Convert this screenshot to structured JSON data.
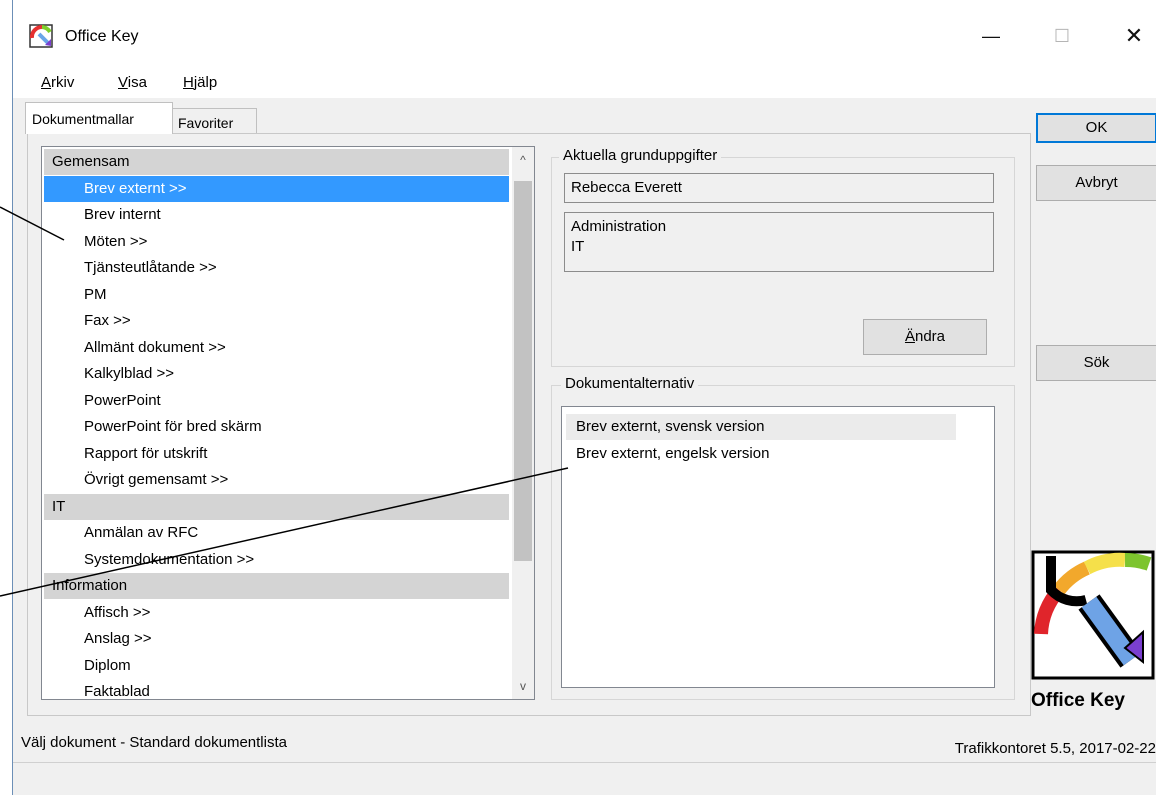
{
  "window": {
    "title": "Office Key",
    "minimize": "—",
    "maximize": "☐",
    "close": "✕"
  },
  "menu": {
    "items": [
      {
        "label": "Arkiv",
        "accel": "A",
        "rest": "rkiv"
      },
      {
        "label": "Visa",
        "accel": "V",
        "rest": "isa"
      },
      {
        "label": "Hjälp",
        "accel": "H",
        "rest": "jälp"
      }
    ]
  },
  "tabs": [
    {
      "label": "Dokumentmallar",
      "active": true
    },
    {
      "label": "Favoriter",
      "active": false
    }
  ],
  "doclist": {
    "rows": [
      {
        "type": "group",
        "label": "Gemensam"
      },
      {
        "type": "item",
        "label": "Brev externt >>",
        "selected": true
      },
      {
        "type": "item",
        "label": "Brev internt"
      },
      {
        "type": "item",
        "label": "Möten >>"
      },
      {
        "type": "item",
        "label": "Tjänsteutlåtande >>"
      },
      {
        "type": "item",
        "label": "PM"
      },
      {
        "type": "item",
        "label": "Fax >>"
      },
      {
        "type": "item",
        "label": "Allmänt dokument >>"
      },
      {
        "type": "item",
        "label": "Kalkylblad >>"
      },
      {
        "type": "item",
        "label": "PowerPoint"
      },
      {
        "type": "item",
        "label": "PowerPoint för bred skärm"
      },
      {
        "type": "item",
        "label": "Rapport för utskrift"
      },
      {
        "type": "item",
        "label": "Övrigt gemensamt >>"
      },
      {
        "type": "group",
        "label": "IT"
      },
      {
        "type": "item",
        "label": "Anmälan av RFC"
      },
      {
        "type": "item",
        "label": "Systemdokumentation >>"
      },
      {
        "type": "group",
        "label": "Information"
      },
      {
        "type": "item",
        "label": "Affisch >>"
      },
      {
        "type": "item",
        "label": "Anslag >>"
      },
      {
        "type": "item",
        "label": "Diplom"
      },
      {
        "type": "item",
        "label": "Faktablad"
      }
    ]
  },
  "grunduppgifter": {
    "label": "Aktuella grunduppgifter",
    "name": "Rebecca Everett",
    "dept_line1": "Administration",
    "dept_line2": "IT",
    "change_button": "Ändra",
    "change_accel": "Ä",
    "change_rest": "ndra"
  },
  "dokumentalternativ": {
    "label": "Dokumentalternativ",
    "options": [
      "Brev externt, svensk version",
      "Brev externt, engelsk version"
    ]
  },
  "buttons": {
    "ok": "OK",
    "cancel": "Avbryt",
    "search": "Sök"
  },
  "logo_text": "Office Key",
  "status": {
    "left": "Välj dokument - Standard dokumentlista",
    "right": "Trafikkontoret 5.5, 2017-02-22"
  }
}
